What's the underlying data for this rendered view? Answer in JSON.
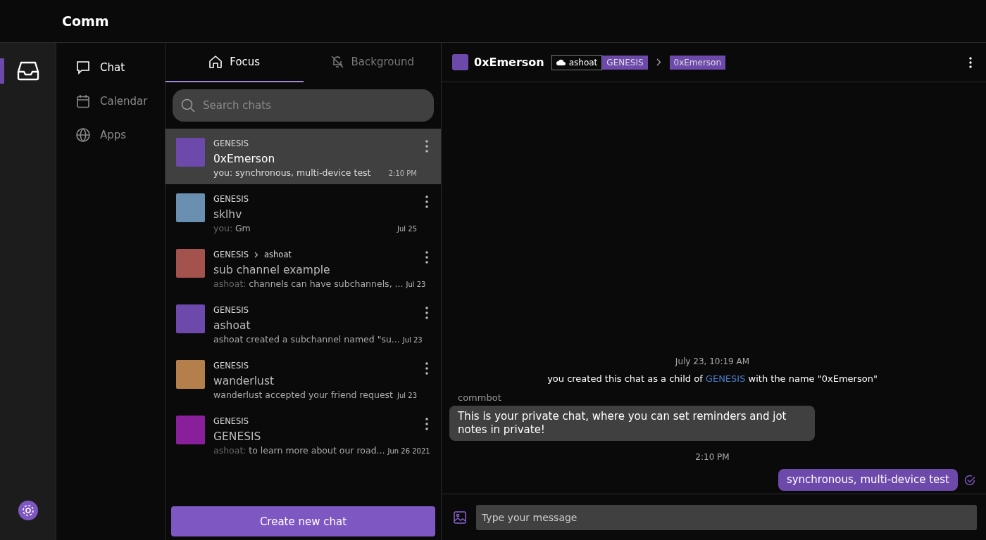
{
  "app_title": "Comm",
  "rail": {
    "items": [
      {
        "selected": true
      }
    ]
  },
  "nav": [
    {
      "label": "Chat",
      "selected": true
    },
    {
      "label": "Calendar",
      "selected": false
    },
    {
      "label": "Apps",
      "selected": false
    }
  ],
  "tabs": [
    {
      "label": "Focus",
      "selected": true
    },
    {
      "label": "Background",
      "selected": false
    }
  ],
  "search": {
    "placeholder": "Search chats"
  },
  "threads": [
    {
      "color": "#6d49ab",
      "community": "GENESIS",
      "name": "0xEmerson",
      "author": "you:",
      "preview": "synchronous, multi-device test",
      "time": "2:10 PM",
      "selected": true
    },
    {
      "color": "#6b8fb0",
      "community": "GENESIS",
      "name": "sklhv",
      "author": "you:",
      "preview": "Gm",
      "time": "Jul 25",
      "selected": false
    },
    {
      "color": "#a3524d",
      "community": "GENESIS",
      "parent": "ashoat",
      "name": "sub channel example",
      "author": "ashoat:",
      "preview": "channels can have subchannels, ...",
      "time": "Jul 23",
      "selected": false
    },
    {
      "color": "#6d49ab",
      "community": "GENESIS",
      "name": "ashoat",
      "preview": "ashoat created a subchannel named \"su...",
      "time": "Jul 23",
      "selected": false
    },
    {
      "color": "#b57f4c",
      "community": "GENESIS",
      "name": "wanderlust",
      "preview": "wanderlust accepted your friend request",
      "time": "Jul 23",
      "selected": false
    },
    {
      "color": "#8a1f9c",
      "community": "GENESIS",
      "name": "GENESIS",
      "author": "ashoat:",
      "preview": "to learn more about our road...",
      "time": "Jun 26 2021",
      "selected": false
    }
  ],
  "create_button": "Create new chat",
  "header": {
    "color": "#6d49ab",
    "name": "0xEmerson",
    "owner": "ashoat",
    "community": "GENESIS",
    "current": "0xEmerson"
  },
  "messages": [
    {
      "kind": "time",
      "text": "July 23, 10:19 AM"
    },
    {
      "kind": "notice",
      "before": "you created this chat as a child of ",
      "link": "GENESIS",
      "after": " with the name \"0xEmerson\""
    },
    {
      "kind": "incoming",
      "author": "commbot",
      "text": "This is your private chat, where you can set reminders and jot notes in private!"
    },
    {
      "kind": "time",
      "text": "2:10 PM"
    },
    {
      "kind": "outgoing",
      "text": "synchronous, multi-device test",
      "delivered": true
    }
  ],
  "composer": {
    "placeholder": "Type your message"
  }
}
